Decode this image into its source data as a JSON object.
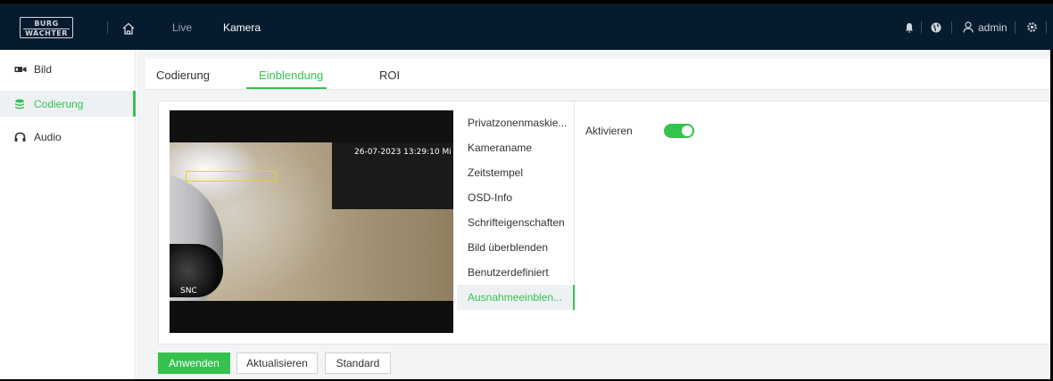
{
  "header": {
    "logo_line1": "BURG",
    "logo_line2": "WÄCHTER",
    "nav": {
      "live": "Live",
      "kamera": "Kamera"
    },
    "user": "admin",
    "icons": [
      "home-icon",
      "bell-icon",
      "globe-icon",
      "user-icon",
      "gear-icon"
    ]
  },
  "sidebar": {
    "items": [
      {
        "label": "Bild",
        "icon": "camera-icon",
        "active": false
      },
      {
        "label": "Codierung",
        "icon": "layers-icon",
        "active": true
      },
      {
        "label": "Audio",
        "icon": "headphones-icon",
        "active": false
      }
    ]
  },
  "tabs": [
    {
      "label": "Codierung",
      "active": false
    },
    {
      "label": "Einblendung",
      "active": true
    },
    {
      "label": "ROI",
      "active": false
    }
  ],
  "video": {
    "timestamp": "26-07-2023 13:29:10 Mi",
    "channel_label": "SNC"
  },
  "osd_menu": {
    "items": [
      "Privatzonenmaskie...",
      "Kameraname",
      "Zeitstempel",
      "OSD-Info",
      "Schrifteigenschaften",
      "Bild überblenden",
      "Benutzerdefiniert",
      "Ausnahmeeinblen..."
    ],
    "active_index": 7
  },
  "settings": {
    "enable_label": "Aktivieren",
    "enabled": true
  },
  "buttons": {
    "apply": "Anwenden",
    "refresh": "Aktualisieren",
    "default": "Standard"
  },
  "colors": {
    "accent": "#35c24f",
    "topbar": "#071b2e"
  }
}
